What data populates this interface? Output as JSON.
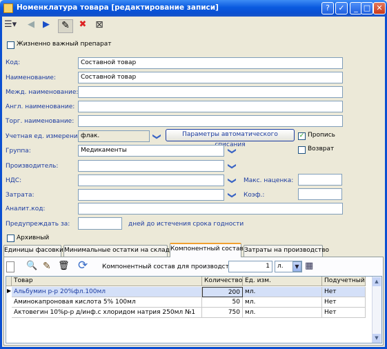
{
  "window": {
    "title": "Номенклатура товара [редактирование записи]"
  },
  "title_buttons": {
    "help": "?",
    "restore": "✓",
    "minimize": "_",
    "maximize": "□",
    "close": "✕"
  },
  "toolbar": {
    "view_menu": "☰▾",
    "back": "◀",
    "forward": "▶",
    "edit": "✎",
    "delete": "✖",
    "close_doc": "⊠"
  },
  "vital_drug": {
    "label": "Жизненно важный препарат",
    "checked": false
  },
  "fields": {
    "code": {
      "label": "Код:",
      "value": "Составной товар"
    },
    "name": {
      "label": "Наименование:",
      "value": "Составной товар"
    },
    "intl_name": {
      "label": "Межд. наименование:",
      "value": ""
    },
    "eng_name": {
      "label": "Англ. наименование:",
      "value": ""
    },
    "trade_name": {
      "label": "Торг. наименование:",
      "value": ""
    },
    "unit": {
      "label": "Учетная ед. измерения:",
      "value": "флак."
    },
    "group": {
      "label": "Группа:",
      "value": "Медикаменты"
    },
    "manufacturer": {
      "label": "Производитель:",
      "value": ""
    },
    "vat": {
      "label": "НДС:",
      "value": ""
    },
    "expense": {
      "label": "Затрата:",
      "value": ""
    },
    "analit_code": {
      "label": "Аналит.код:",
      "value": ""
    },
    "warn": {
      "label": "Предупреждать за:",
      "value": "",
      "suffix": "дней до истечения срока годности"
    },
    "max_markup": {
      "label": "Макс. наценка:",
      "value": ""
    },
    "coef": {
      "label": "Коэф.:",
      "value": ""
    }
  },
  "auto_writeoff_button": "Параметры автоматического списания",
  "propis": {
    "label": "Пропись",
    "checked": true
  },
  "vozvrat": {
    "label": "Возврат",
    "checked": false
  },
  "archive": {
    "label": "Архивный",
    "checked": false
  },
  "tabs": [
    "Единицы фасовки",
    "Минимальные остатки на складах",
    "Компонентный состав",
    "Затраты на производство"
  ],
  "active_tab": 2,
  "component_panel": {
    "label": "Компонентный состав для производства:",
    "quantity": "1",
    "unit": "л.",
    "icons": {
      "new": "▭",
      "search": "🔍",
      "edit": "✎",
      "delete": "🗑",
      "refresh": "⟳",
      "calc": "▦"
    },
    "columns": [
      "Товар",
      "Количество",
      "Ед. изм.",
      "Подучетный"
    ],
    "rows": [
      {
        "item": "Альбумин р-р 20%фл.100мл",
        "qty": "200",
        "unit": "мл.",
        "sub": "Нет"
      },
      {
        "item": "Аминокапроновая кислота 5% 100мл",
        "qty": "50",
        "unit": "мл.",
        "sub": "Нет"
      },
      {
        "item": "Актовегин 10%р-р д/инф.с хлоридом натрия 250мл №1",
        "qty": "750",
        "unit": "мл.",
        "sub": "Нет"
      }
    ],
    "row_marker": "▶"
  },
  "scroll": {
    "up": "▲",
    "down": "▼"
  },
  "dropdown_arrow": "❯"
}
